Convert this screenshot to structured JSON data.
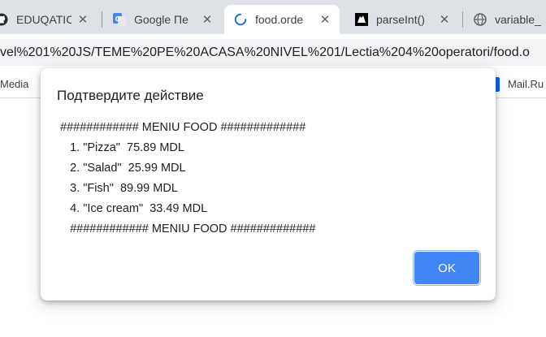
{
  "tabs": [
    {
      "label": "EDUQATIC",
      "icon": "github-icon"
    },
    {
      "label": "Google Пе",
      "icon": "google-translate-icon"
    },
    {
      "label": "food.orde",
      "icon": "loading-spinner-icon",
      "active": true
    },
    {
      "label": "parseInt()",
      "icon": "mdn-icon"
    },
    {
      "label": "variable_",
      "icon": "globe-icon"
    }
  ],
  "address_bar": {
    "url": "vel%201%20JS/TEME%20PE%20ACASA%20NIVEL%201/Lectia%204%20operatori/food.o"
  },
  "bookmarks": [
    {
      "label": "Media"
    },
    {
      "label": "Mail.Ru",
      "icon": "mailru-icon"
    }
  ],
  "dialog": {
    "title": "Подтвердите действие",
    "message_lines": [
      "############ MENIU FOOD #############",
      "   1. \"Pizza\"  75.89 MDL",
      "   2. \"Salad\"  25.99 MDL",
      "   3. \"Fish\"  89.99 MDL",
      "   4. \"Ice cream\"  33.49 MDL",
      "   ############ MENIU FOOD #############"
    ],
    "ok_label": "OK"
  },
  "colors": {
    "accent": "#4285f4",
    "tabstrip": "#dee1e6",
    "spinner": "#1a73e8"
  }
}
